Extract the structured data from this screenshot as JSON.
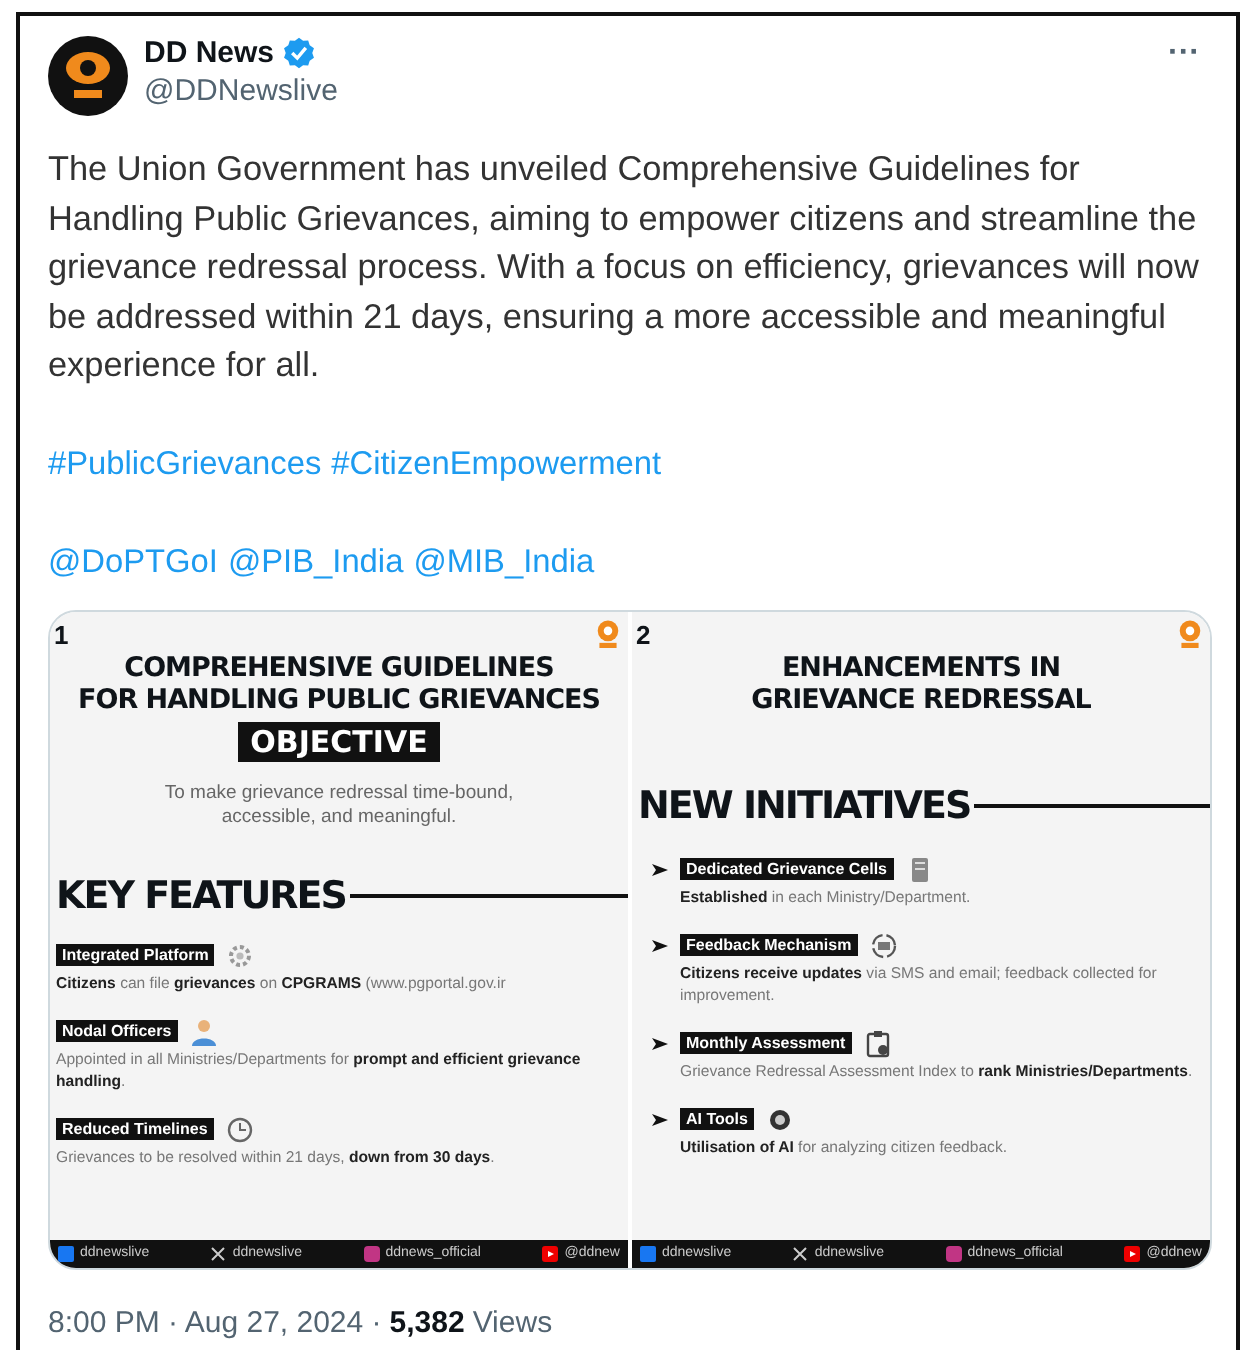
{
  "tweet": {
    "name": "DD News",
    "verified": true,
    "handle": "@DDNewslive",
    "more": "···",
    "text": "The Union Government has unveiled Comprehensive Guidelines for Handling Public Grievances, aiming to empower citizens and streamline the grievance redressal process. With a focus on efficiency, grievances will now be addressed within 21 days, ensuring a more accessible and meaningful experience for all.",
    "hashtags": [
      "#PublicGrievances",
      "#CitizenEmpowerment"
    ],
    "mentions": [
      "@DoPTGoI",
      "@PIB_India",
      "@MIB_India"
    ]
  },
  "media": [
    {
      "number": "1",
      "title": [
        "COMPREHENSIVE GUIDELINES",
        "FOR HANDLING PUBLIC GRIEVANCES"
      ],
      "objective_label": "OBJECTIVE",
      "objective": "To make grievance redressal time-bound, accessible, and meaningful.",
      "section": "KEY FEATURES",
      "kind": "features",
      "items": [
        {
          "label": "Integrated Platform",
          "kind": "gear",
          "text": "**Citizens** can file **grievances** on **CPGRAMS** (www.pgportal.gov.ir"
        },
        {
          "label": "Nodal Officers",
          "kind": "person",
          "text": "Appointed in all Ministries/Departments for **prompt and efficient grievance handling**."
        },
        {
          "label": "Reduced Timelines",
          "kind": "clock",
          "text": "Grievances to be resolved within 21 days, **down from 30 days**."
        }
      ],
      "footer": [
        "ddnewslive",
        "ddnewslive",
        "ddnews_official",
        "@ddnew"
      ]
    },
    {
      "number": "2",
      "title": [
        "ENHANCEMENTS IN",
        "GRIEVANCE REDRESSAL"
      ],
      "section": "NEW INITIATIVES",
      "kind": "initiatives",
      "items": [
        {
          "label": "Dedicated Grievance Cells",
          "kind": "document",
          "text": "**Established** in each Ministry/Department."
        },
        {
          "label": "Feedback Mechanism",
          "kind": "cycle",
          "text": "**Citizens receive updates** via SMS and email; feedback collected for improvement."
        },
        {
          "label": "Monthly Assessment",
          "kind": "clipboard",
          "text": "Grievance Redressal Assessment Index to **rank Ministries/Departments**."
        },
        {
          "label": "AI Tools",
          "kind": "chip",
          "text": "**Utilisation of AI** for analyzing citizen feedback."
        }
      ],
      "footer": [
        "ddnewslive",
        "ddnewslive",
        "ddnews_official",
        "@ddnew"
      ]
    }
  ],
  "meta": {
    "time": "8:00 PM · Aug 27, 2024 ·",
    "views": "5,382",
    "views_label": "Views"
  }
}
